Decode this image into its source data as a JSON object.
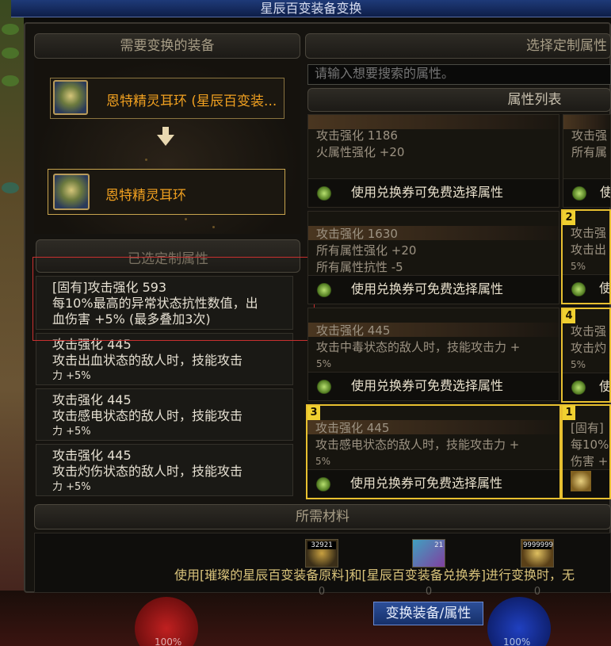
{
  "window": {
    "title": "星辰百变装备变换"
  },
  "left": {
    "header": "需要变换的装备",
    "source_item": "恩特精灵耳环 (星辰百变装...",
    "target_item": "恩特精灵耳环",
    "selected_header": "已选定制属性",
    "selected_attrs": [
      {
        "l1": "[固有]攻击强化 593",
        "l2": "每10%最高的异常状态抗性数值，出",
        "l3": "血伤害 +5% (最多叠加3次)"
      },
      {
        "l1": "攻击强化 445",
        "l2": "攻击出血状态的敌人时，技能攻击",
        "l3": "力 +5%"
      },
      {
        "l1": "攻击强化 445",
        "l2": "攻击感电状态的敌人时，技能攻击",
        "l3": "力 +5%"
      },
      {
        "l1": "攻击强化 445",
        "l2": "攻击灼伤状态的敌人时，技能攻击",
        "l3": "力 +5%"
      }
    ]
  },
  "right": {
    "header": "选择定制属性",
    "search_placeholder": "请输入想要搜索的属性。",
    "list_header": "属性列表",
    "coupon_text": "使用兑换券可免费选择属性",
    "options": [
      {
        "l1": "攻击强化 1186",
        "l2": "火属性强化 +20",
        "l3": ""
      },
      {
        "l1": "攻击强化 1630",
        "l2": "所有属性强化 +20",
        "l3": "所有属性抗性 -5"
      },
      {
        "l1": "攻击强化 445",
        "l2": "攻击中毒状态的敌人时，技能攻击力 +",
        "l3": "5%"
      },
      {
        "l1": "攻击强化 445",
        "l2": "攻击感电状态的敌人时，技能攻击力 +",
        "l3": "5%",
        "badge": "3"
      }
    ],
    "side_options": [
      {
        "l1": "攻击强",
        "l2": "所有属",
        "badge": ""
      },
      {
        "l1": "攻击强",
        "l2": "攻击出",
        "l3": "5%",
        "badge": "2"
      },
      {
        "l1": "攻击强",
        "l2": "攻击灼",
        "l3": "5%",
        "badge": "4"
      },
      {
        "l1": "[固有]",
        "l2": "每10%最",
        "l3": "伤害 +",
        "badge": "1"
      }
    ],
    "side_coupon": "使"
  },
  "materials": {
    "header": "所需材料",
    "items": [
      {
        "count": "32921",
        "have": "0"
      },
      {
        "count": "21",
        "have": "0"
      },
      {
        "count": "9999999",
        "have": "0"
      }
    ],
    "note": "使用[璀璨的星辰百变装备原料]和[星辰百变装备兑换券]进行变换时，无"
  },
  "bottom": {
    "convert_button": "变换装备/属性",
    "hp": "100%",
    "mp": "100%"
  }
}
